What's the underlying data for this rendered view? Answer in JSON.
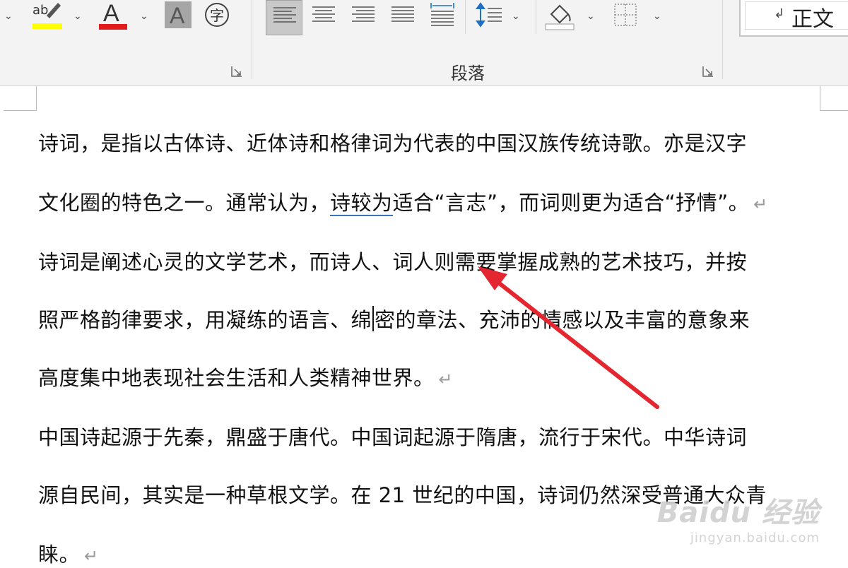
{
  "ribbon": {
    "paragraph_group_label": "段落",
    "style_name": "正文",
    "style_mark": "↲",
    "highlight_color": "#ffff00",
    "font_color": "#e21b1b",
    "font_color_letter": "A",
    "shade_letter": "A",
    "enclose_char": "字",
    "dropdown_glyph": "⌄",
    "highlight_text": "ab"
  },
  "document": {
    "lines": [
      "诗词，是指以古体诗、近体诗和格律词为代表的中国汉族传统诗歌。亦是汉字",
      "文化圈的特色之一。通常认为，",
      "诗较为",
      "适合“言志”，而词则更为适合“抒情”。",
      "诗词是阐述心灵的文学艺术，而诗人、词人则需要掌握成熟的艺术技巧，并按",
      "照严格韵律要求，用凝练的语言、绵",
      "密的章法、充沛的情感以及丰富的意象来",
      "高度集中地表现社会生活和人类精神世界。",
      "中国诗起源于先秦，鼎盛于唐代。中国词起源于隋唐，流行于宋代。中华诗词",
      "源自民间，其实是一种草根文学。在 21 世纪的中国，诗词仍然深受普通大众青",
      "睐。"
    ],
    "paragraph_mark": "↵"
  },
  "watermark": {
    "brand": "Baidu 经验",
    "url": "jingyan.baidu.com"
  },
  "colors": {
    "annotation_arrow": "#e3262f"
  }
}
